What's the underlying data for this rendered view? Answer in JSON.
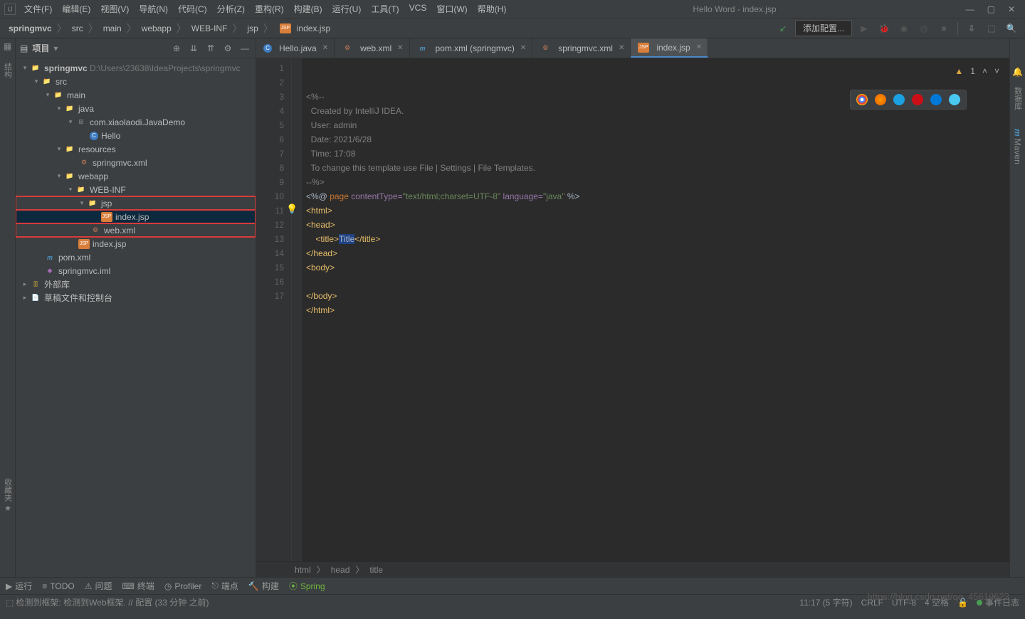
{
  "title": "Hello Word - index.jsp",
  "menus": [
    "文件(F)",
    "编辑(E)",
    "视图(V)",
    "导航(N)",
    "代码(C)",
    "分析(Z)",
    "重构(R)",
    "构建(B)",
    "运行(U)",
    "工具(T)",
    "VCS",
    "窗口(W)",
    "帮助(H)"
  ],
  "breadcrumbs": [
    "springmvc",
    "src",
    "main",
    "webapp",
    "WEB-INF",
    "jsp",
    "index.jsp"
  ],
  "nav": {
    "addConfig": "添加配置..."
  },
  "projectPanel": {
    "title": "项目"
  },
  "tree": {
    "root": {
      "name": "springmvc",
      "path": "D:\\Users\\23638\\IdeaProjects\\springmvc"
    },
    "src": "src",
    "main": "main",
    "java": "java",
    "pkg": "com.xiaolaodi.JavaDemo",
    "hello": "Hello",
    "resources": "resources",
    "springmvcXml": "springmvc.xml",
    "webapp": "webapp",
    "webinf": "WEB-INF",
    "jspFolder": "jsp",
    "indexJspInner": "index.jsp",
    "webXml": "web.xml",
    "indexJsp": "index.jsp",
    "pom": "pom.xml",
    "iml": "springmvc.iml",
    "extLibs": "外部库",
    "scratch": "草稿文件和控制台"
  },
  "tabs": [
    {
      "label": "Hello.java",
      "icon": "class"
    },
    {
      "label": "web.xml",
      "icon": "xml"
    },
    {
      "label": "pom.xml (springmvc)",
      "icon": "maven"
    },
    {
      "label": "springmvc.xml",
      "icon": "xml"
    },
    {
      "label": "index.jsp",
      "icon": "jsp",
      "active": true
    }
  ],
  "editor": {
    "warnCount": "1",
    "lines": [
      "<%--",
      "  Created by IntelliJ IDEA.",
      "  User: admin",
      "  Date: 2021/6/28",
      "  Time: 17:08",
      "  To change this template use File | Settings | File Templates.",
      "--%>",
      "",
      "",
      "",
      "",
      "",
      "",
      "",
      "",
      "",
      ""
    ],
    "l8": {
      "a": "<%@ ",
      "b": "page",
      "c": " contentType=",
      "d": "\"text/html;charset=UTF-8\"",
      "e": " language=",
      "f": "\"java\"",
      "g": " %>"
    },
    "titleText": "Title",
    "crumbs": [
      "html",
      "head",
      "title"
    ]
  },
  "bottomTools": [
    "运行",
    "TODO",
    "问题",
    "终端",
    "Profiler",
    "端点",
    "构建",
    "Spring"
  ],
  "status": {
    "left": "检测到框架: 检测到Web框架. // 配置 (33 分钟 之前)",
    "pos": "11:17 (5 字符)",
    "lineSep": "CRLF",
    "encoding": "UTF-8",
    "indent": "4 空格",
    "event": "事件日志"
  },
  "watermark": "https://blog.csdn.net/qq_45619623",
  "rightGutter": {
    "db": "数据库",
    "maven": "Maven"
  }
}
